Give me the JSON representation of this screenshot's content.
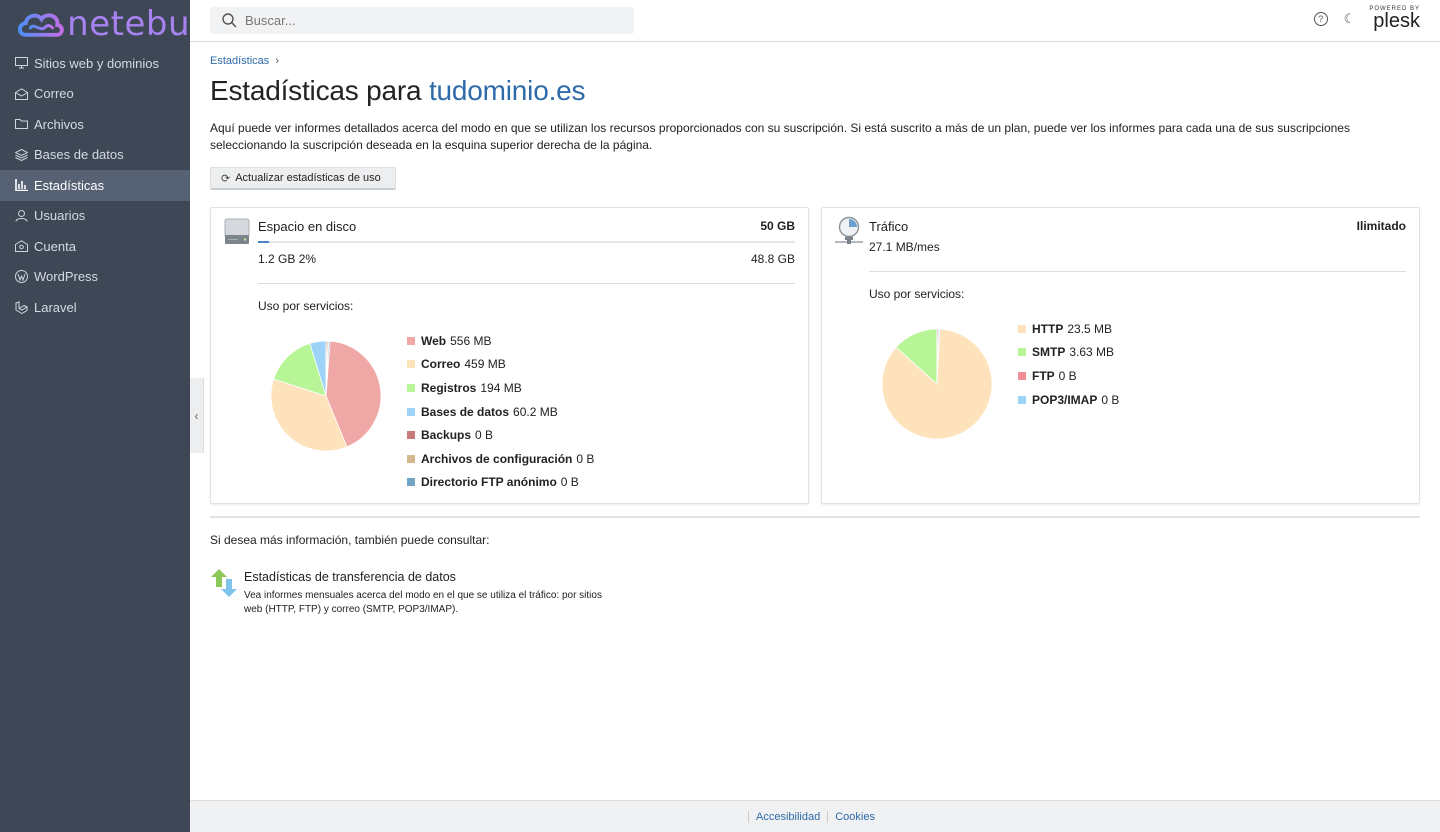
{
  "app": {
    "logo_text": "netebu",
    "brand_color": "#a882ef"
  },
  "sidebar": {
    "items": [
      {
        "label": "Sitios web y dominios",
        "icon": "monitor-icon"
      },
      {
        "label": "Correo",
        "icon": "mail-icon"
      },
      {
        "label": "Archivos",
        "icon": "folder-icon"
      },
      {
        "label": "Bases de datos",
        "icon": "database-icon"
      },
      {
        "label": "Estadísticas",
        "icon": "bar-chart-icon",
        "active": true
      },
      {
        "label": "Usuarios",
        "icon": "user-icon"
      },
      {
        "label": "Cuenta",
        "icon": "account-icon"
      },
      {
        "label": "WordPress",
        "icon": "wordpress-icon"
      },
      {
        "label": "Laravel",
        "icon": "laravel-icon"
      }
    ]
  },
  "topbar": {
    "search_placeholder": "Buscar...",
    "powered_by": "POWERED BY",
    "plesk": "plesk"
  },
  "breadcrumb": {
    "item": "Estadísticas"
  },
  "page": {
    "title_prefix": "Estadísticas para",
    "title_domain": "tudominio.es",
    "description": "Aquí puede ver informes detallados acerca del modo en que se utilizan los recursos proporcionados con su suscripción. Si está suscrito a más de un plan, puede ver los informes para cada una de sus suscripciones seleccionando la suscripción deseada en la esquina superior derecha de la página.",
    "refresh_button": "Actualizar estadísticas de uso"
  },
  "disk": {
    "title": "Espacio en disco",
    "total": "50 GB",
    "used": "1.2 GB 2%",
    "free": "48.8 GB",
    "usage_fraction": 0.02,
    "usage_label": "Uso por servicios:",
    "services": [
      {
        "name": "Web",
        "value": "556 MB",
        "color": "#f0a8a6"
      },
      {
        "name": "Correo",
        "value": "459 MB",
        "color": "#fde2bb"
      },
      {
        "name": "Registros",
        "value": "194 MB",
        "color": "#b8f596"
      },
      {
        "name": "Bases de datos",
        "value": "60.2 MB",
        "color": "#9dd3f6"
      },
      {
        "name": "Backups",
        "value": "0 B",
        "color": "#c97b7b"
      },
      {
        "name": "Archivos de configuración",
        "value": "0 B",
        "color": "#d4b98c"
      },
      {
        "name": "Directorio FTP anónimo",
        "value": "0 B",
        "color": "#74a4c6"
      }
    ]
  },
  "traffic": {
    "title": "Tráfico",
    "limit": "Ilimitado",
    "used": "27.1 MB/mes",
    "usage_label": "Uso por servicios:",
    "services": [
      {
        "name": "HTTP",
        "value": "23.5 MB",
        "color": "#fde2bb"
      },
      {
        "name": "SMTP",
        "value": "3.63 MB",
        "color": "#b8f596"
      },
      {
        "name": "FTP",
        "value": "0 B",
        "color": "#ee9096"
      },
      {
        "name": "POP3/IMAP",
        "value": "0 B",
        "color": "#9dd3f6"
      }
    ]
  },
  "more_info": {
    "intro": "Si desea más información, también puede consultar:",
    "link_title": "Estadísticas de transferencia de datos",
    "link_desc": "Vea informes mensuales acerca del modo en el que se utiliza el tráfico: por sitios web (HTTP, FTP) y correo (SMTP, POP3/IMAP)."
  },
  "footer": {
    "accessibility": "Accesibilidad",
    "cookies": "Cookies"
  }
}
